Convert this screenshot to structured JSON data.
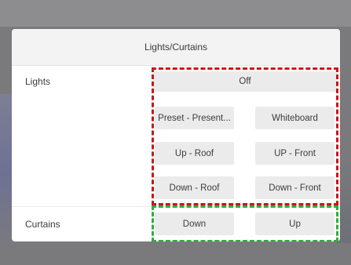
{
  "dialog": {
    "title": "Lights/Curtains"
  },
  "lights": {
    "label": "Lights",
    "off_label": "Off",
    "buttons": [
      "Preset - Present...",
      "Whiteboard",
      "Up - Roof",
      "UP - Front",
      "Down - Roof",
      "Down - Front"
    ]
  },
  "curtains": {
    "label": "Curtains",
    "buttons": [
      "Down",
      "Up"
    ]
  },
  "colors": {
    "highlight_lights": "#c8161d",
    "highlight_curtains": "#2fae3b"
  }
}
